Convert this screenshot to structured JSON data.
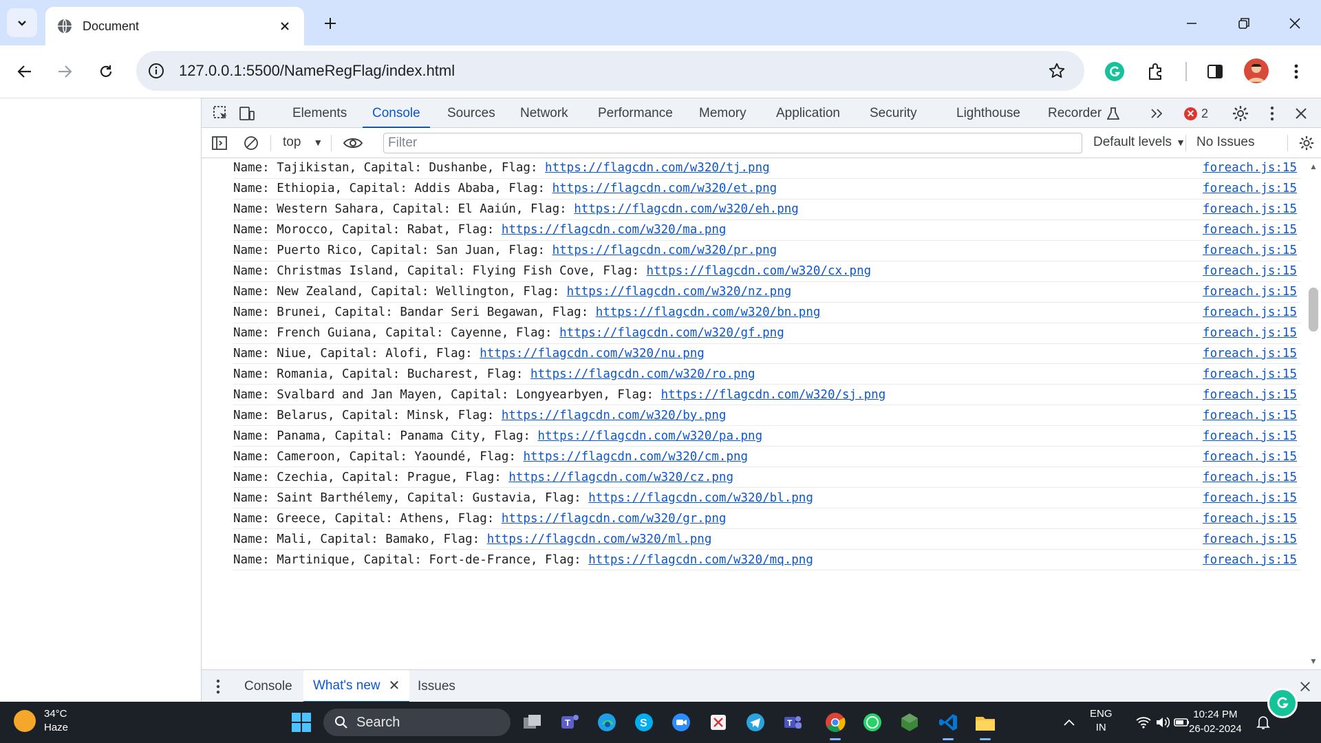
{
  "browser": {
    "tab_title": "Document",
    "url": "127.0.0.1:5500/NameRegFlag/index.html"
  },
  "devtools": {
    "tabs": [
      "Elements",
      "Console",
      "Sources",
      "Network",
      "Performance",
      "Memory",
      "Application",
      "Security",
      "Lighthouse",
      "Recorder"
    ],
    "active_tab": "Console",
    "error_count": "2",
    "context": "top",
    "filter_placeholder": "Filter",
    "levels": "Default levels",
    "issues": "No Issues",
    "drawer_tabs": [
      "Console",
      "What's new",
      "Issues"
    ],
    "active_drawer_tab": "What's new"
  },
  "console_rows": [
    {
      "prefix": "Name: Tajikistan, Capital: Dushanbe, Flag: ",
      "link": "https://flagcdn.com/w320/tj.png",
      "source": "foreach.js:15"
    },
    {
      "prefix": "Name: Ethiopia, Capital: Addis Ababa, Flag: ",
      "link": "https://flagcdn.com/w320/et.png",
      "source": "foreach.js:15"
    },
    {
      "prefix": "Name: Western Sahara, Capital: El Aaiún, Flag: ",
      "link": "https://flagcdn.com/w320/eh.png",
      "source": "foreach.js:15"
    },
    {
      "prefix": "Name: Morocco, Capital: Rabat, Flag: ",
      "link": "https://flagcdn.com/w320/ma.png",
      "source": "foreach.js:15"
    },
    {
      "prefix": "Name: Puerto Rico, Capital: San Juan, Flag: ",
      "link": "https://flagcdn.com/w320/pr.png",
      "source": "foreach.js:15"
    },
    {
      "prefix": "Name: Christmas Island, Capital: Flying Fish Cove, Flag: ",
      "link": "https://flagcdn.com/w320/cx.png",
      "source": "foreach.js:15"
    },
    {
      "prefix": "Name: New Zealand, Capital: Wellington, Flag: ",
      "link": "https://flagcdn.com/w320/nz.png",
      "source": "foreach.js:15"
    },
    {
      "prefix": "Name: Brunei, Capital: Bandar Seri Begawan, Flag: ",
      "link": "https://flagcdn.com/w320/bn.png",
      "source": "foreach.js:15"
    },
    {
      "prefix": "Name: French Guiana, Capital: Cayenne, Flag: ",
      "link": "https://flagcdn.com/w320/gf.png",
      "source": "foreach.js:15"
    },
    {
      "prefix": "Name: Niue, Capital: Alofi, Flag: ",
      "link": "https://flagcdn.com/w320/nu.png",
      "source": "foreach.js:15"
    },
    {
      "prefix": "Name: Romania, Capital: Bucharest, Flag: ",
      "link": "https://flagcdn.com/w320/ro.png",
      "source": "foreach.js:15"
    },
    {
      "prefix": "Name: Svalbard and Jan Mayen, Capital: Longyearbyen, Flag: ",
      "link": "https://flagcdn.com/w320/sj.png",
      "source": "foreach.js:15"
    },
    {
      "prefix": "Name: Belarus, Capital: Minsk, Flag: ",
      "link": "https://flagcdn.com/w320/by.png",
      "source": "foreach.js:15"
    },
    {
      "prefix": "Name: Panama, Capital: Panama City, Flag: ",
      "link": "https://flagcdn.com/w320/pa.png",
      "source": "foreach.js:15"
    },
    {
      "prefix": "Name: Cameroon, Capital: Yaoundé, Flag: ",
      "link": "https://flagcdn.com/w320/cm.png",
      "source": "foreach.js:15"
    },
    {
      "prefix": "Name: Czechia, Capital: Prague, Flag: ",
      "link": "https://flagcdn.com/w320/cz.png",
      "source": "foreach.js:15"
    },
    {
      "prefix": "Name: Saint Barthélemy, Capital: Gustavia, Flag: ",
      "link": "https://flagcdn.com/w320/bl.png",
      "source": "foreach.js:15"
    },
    {
      "prefix": "Name: Greece, Capital: Athens, Flag: ",
      "link": "https://flagcdn.com/w320/gr.png",
      "source": "foreach.js:15"
    },
    {
      "prefix": "Name: Mali, Capital: Bamako, Flag: ",
      "link": "https://flagcdn.com/w320/ml.png",
      "source": "foreach.js:15"
    },
    {
      "prefix": "Name: Martinique, Capital: Fort-de-France, Flag: ",
      "link": "https://flagcdn.com/w320/mq.png",
      "source": "foreach.js:15"
    }
  ],
  "taskbar": {
    "temperature": "34°C",
    "weather": "Haze",
    "search_label": "Search",
    "language": "ENG",
    "region": "IN",
    "time": "10:24 PM",
    "date": "26-02-2024"
  },
  "colors": {
    "accent": "#0b57d0",
    "tabstrip": "#d3e3fd",
    "error": "#dc362e",
    "taskbar": "#1c2128"
  }
}
